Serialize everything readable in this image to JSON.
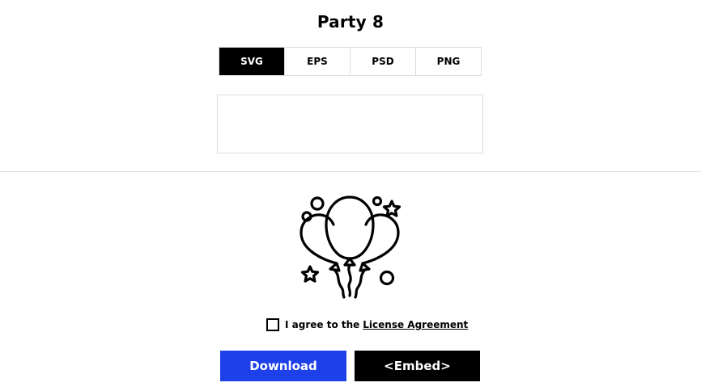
{
  "title": "Party 8",
  "formats": [
    "SVG",
    "EPS",
    "PSD",
    "PNG"
  ],
  "active_format": "SVG",
  "icon": "party-balloons-icon",
  "agreement": {
    "prefix": "I agree to the",
    "link": "License Agreement",
    "checked": false
  },
  "buttons": {
    "download": "Download",
    "embed": "<Embed>"
  },
  "colors": {
    "download_bg": "#1e40e8",
    "embed_bg": "#000000",
    "active_tab_bg": "#000000"
  }
}
